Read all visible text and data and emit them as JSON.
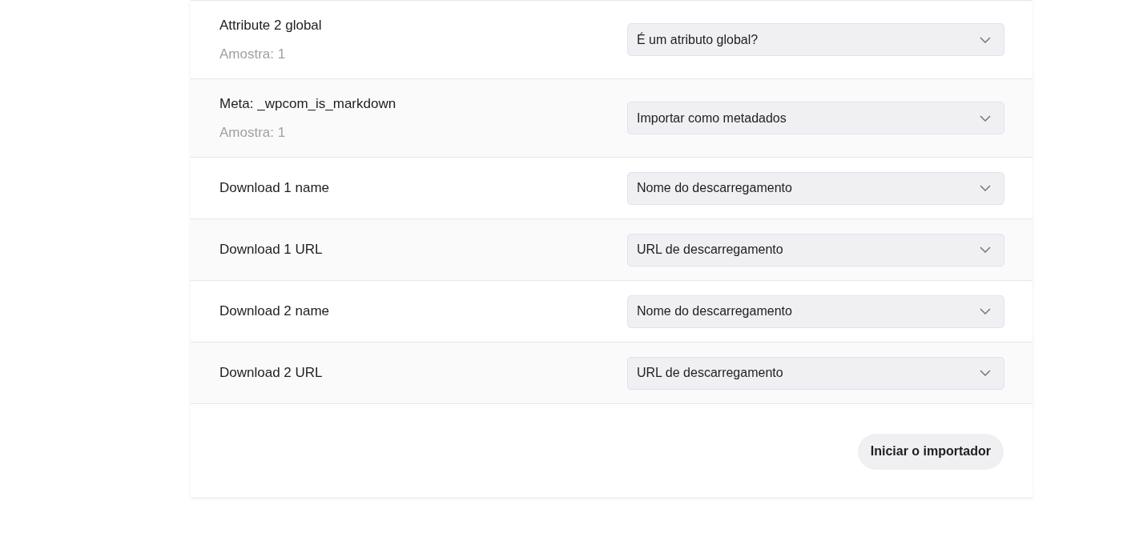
{
  "rows": [
    {
      "label": "Attribute 2 global",
      "sample": "Amostra: 1",
      "mapping": "É um atributo global?"
    },
    {
      "label": "Meta: _wpcom_is_markdown",
      "sample": "Amostra: 1",
      "mapping": "Importar como metadados"
    },
    {
      "label": "Download 1 name",
      "mapping": "Nome do descarregamento"
    },
    {
      "label": "Download 1 URL",
      "mapping": "URL de descarregamento"
    },
    {
      "label": "Download 2 name",
      "mapping": "Nome do descarregamento"
    },
    {
      "label": "Download 2 URL",
      "mapping": "URL de descarregamento"
    }
  ],
  "submit_button": "Iniciar o importador"
}
